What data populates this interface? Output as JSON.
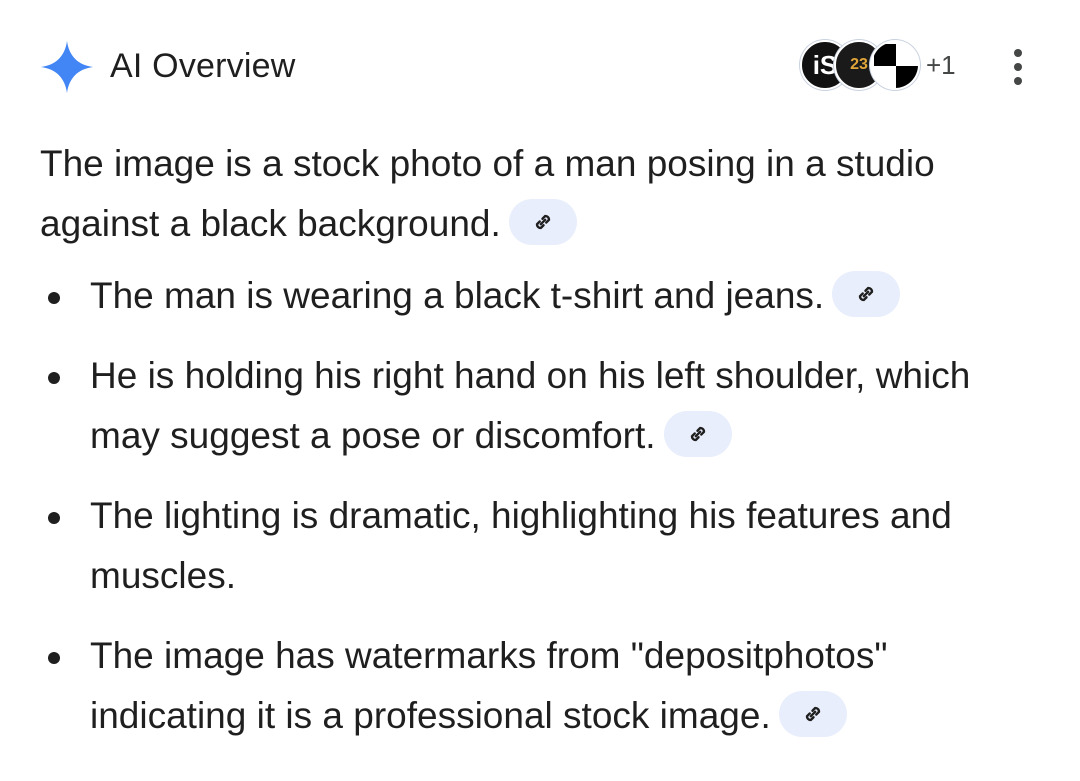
{
  "header": {
    "title": "AI Overview",
    "sparkle_color": "#4285f4",
    "sources": {
      "avatars": [
        {
          "icon": "istock-logo",
          "label": "iS"
        },
        {
          "icon": "source-23-logo",
          "label": "23"
        },
        {
          "icon": "checker-logo",
          "label": ""
        }
      ],
      "more_count": "+1"
    },
    "more_options_icon": "more-vert-icon"
  },
  "content": {
    "intro": "The image is a stock photo of a man posing in a studio against a black background.",
    "bullets": [
      {
        "text": "The man is wearing a black t-shirt and jeans."
      },
      {
        "text": "He is holding his right hand on his left shoulder, which may suggest a pose or discomfort."
      },
      {
        "text": "The lighting is dramatic, highlighting his features and muscles."
      },
      {
        "text": "The image has watermarks from \"depositphotos\" indicating it is a professional stock image."
      }
    ],
    "link_icon": "link-icon",
    "chip_color": "#e8eefb"
  }
}
